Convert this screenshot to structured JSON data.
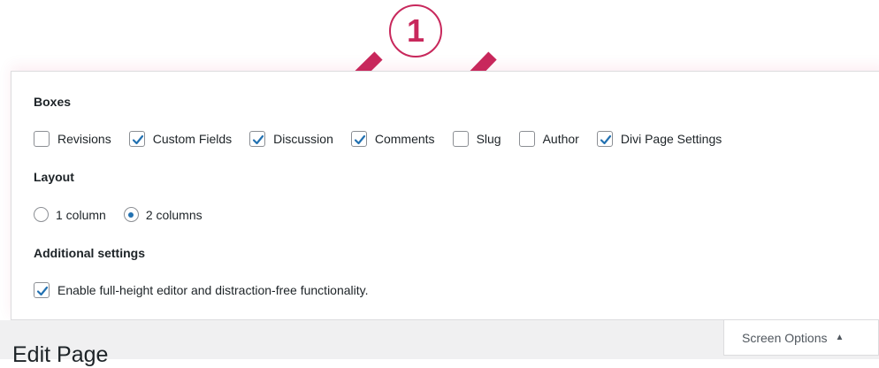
{
  "annotation": {
    "step_number": "1",
    "accent_color": "#c8285c"
  },
  "boxes": {
    "title": "Boxes",
    "items": [
      {
        "label": "Revisions",
        "checked": false
      },
      {
        "label": "Custom Fields",
        "checked": true
      },
      {
        "label": "Discussion",
        "checked": true
      },
      {
        "label": "Comments",
        "checked": true
      },
      {
        "label": "Slug",
        "checked": false
      },
      {
        "label": "Author",
        "checked": false
      },
      {
        "label": "Divi Page Settings",
        "checked": true
      }
    ]
  },
  "layout": {
    "title": "Layout",
    "options": [
      {
        "label": "1 column",
        "selected": false
      },
      {
        "label": "2 columns",
        "selected": true
      }
    ]
  },
  "additional": {
    "title": "Additional settings",
    "items": [
      {
        "label": "Enable full-height editor and distraction-free functionality.",
        "checked": true
      }
    ]
  },
  "page": {
    "title": "Edit Page"
  },
  "screen_options": {
    "label": "Screen Options",
    "caret": "▲"
  },
  "colors": {
    "checkmark": "#2271b1",
    "arrow": "#c8285c"
  }
}
